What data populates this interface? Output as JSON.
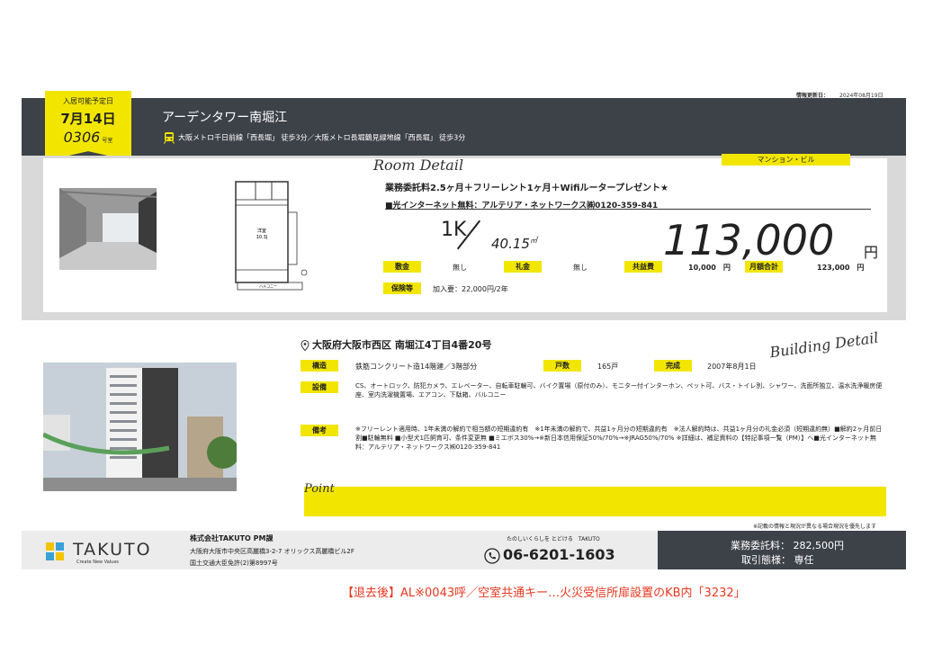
{
  "header": {
    "update_label": "情報更新日：",
    "update_date": "2024年08月19日",
    "building_name": "アーデンタワー南堀江",
    "station": "大阪メトロ千日前線「西長堀」 徒歩3分／大阪メトロ長堀鶴見緑地線「西長堀」 徒歩3分"
  },
  "badge": {
    "label": "入居可能予定日",
    "date": "7月14日",
    "room": "0306",
    "room_suffix": "号室"
  },
  "room_detail": {
    "title": "Room Detail",
    "type_tag": "マンション・ビル",
    "campaign": "業務委託料2.5ヶ月＋フリーレント1ヶ月＋Wifiルータープレゼント★",
    "internet": "■光インターネット無料：アルテリア・ネットワークス㈱0120-359-841",
    "layout": "1K",
    "area": "40.15",
    "area_unit": "㎡",
    "rent": "113,000",
    "rent_unit": "円",
    "floorplan_room": "洋室",
    "floorplan_size": "10.3J",
    "floorplan_balcony": "バルコニー",
    "fees": [
      {
        "label": "敷金",
        "value": "無し"
      },
      {
        "label": "礼金",
        "value": "無し"
      },
      {
        "label": "共益費",
        "value": "10,000　円"
      },
      {
        "label": "月額合計",
        "value": "123,000　円"
      }
    ],
    "insurance_label": "保険等",
    "insurance_value": "加入要：22,000円/2年"
  },
  "building": {
    "title": "Building Detail",
    "address": "大阪府大阪市西区 南堀江4丁目4番20号",
    "structure_label": "構造",
    "structure_value": "鉄筋コンクリート造14階建／3階部分",
    "units_label": "戸数",
    "units_value": "165戸",
    "completed_label": "完成",
    "completed_value": "2007年8月1日",
    "equipment_label": "設備",
    "equipment_value": "CS、オートロック、防犯カメラ、エレベーター、自転車駐輪可、バイク置場（原付のみ）、モニター付インターホン、ペット可、バス・トイレ別、シャワー、洗面所独立、温水洗浄暖房便座、室内洗濯機置場、エアコン、下駄箱、バルコニー",
    "remarks_label": "備考",
    "remarks_value": "※フリーレント適用時、1年未満の解約で相当額の短期違約有　※1年未満の解約で、共益1ヶ月分の短期違約有　※法人解約時は、共益1ヶ月分の礼金必須（短期違約無）■解約2ヶ月前日割■駐輪無料 ■小型犬1匹飼育可、条件変更無 ■ミエボス30%→※新日本信用保証50%/70%→※JRAG50%/70% ※詳細は、補足資料の【特記事項一覧（PM）】へ■光インターネット無料：アルテリア・ネットワークス㈱0120-359-841"
  },
  "point": {
    "title": "Point",
    "note": "※記載の情報と現況が異なる場合現況を優先します"
  },
  "footer": {
    "logo": "TAKUTO",
    "logo_sub": "Create New Values",
    "company": "株式会社TAKUTO PM課",
    "address": "大阪府大阪市中央区高麗橋3-2-7 オリックス高麗橋ビル2F",
    "license": "国土交通大臣免許(2)第8997号",
    "tagline": "たのしいくらしを とどける　TAKUTO",
    "phone": "06-6201-1603",
    "fee": "業務委託料：  282,500円",
    "deal": "取引態様：  専任"
  },
  "remark": "【退去後】AL※0043呼／空室共通キー…火災受信所扉設置のKB内「3232」",
  "colors": {
    "accent": "#f2e600",
    "dark": "#3d4148",
    "remark": "#e5371f"
  }
}
